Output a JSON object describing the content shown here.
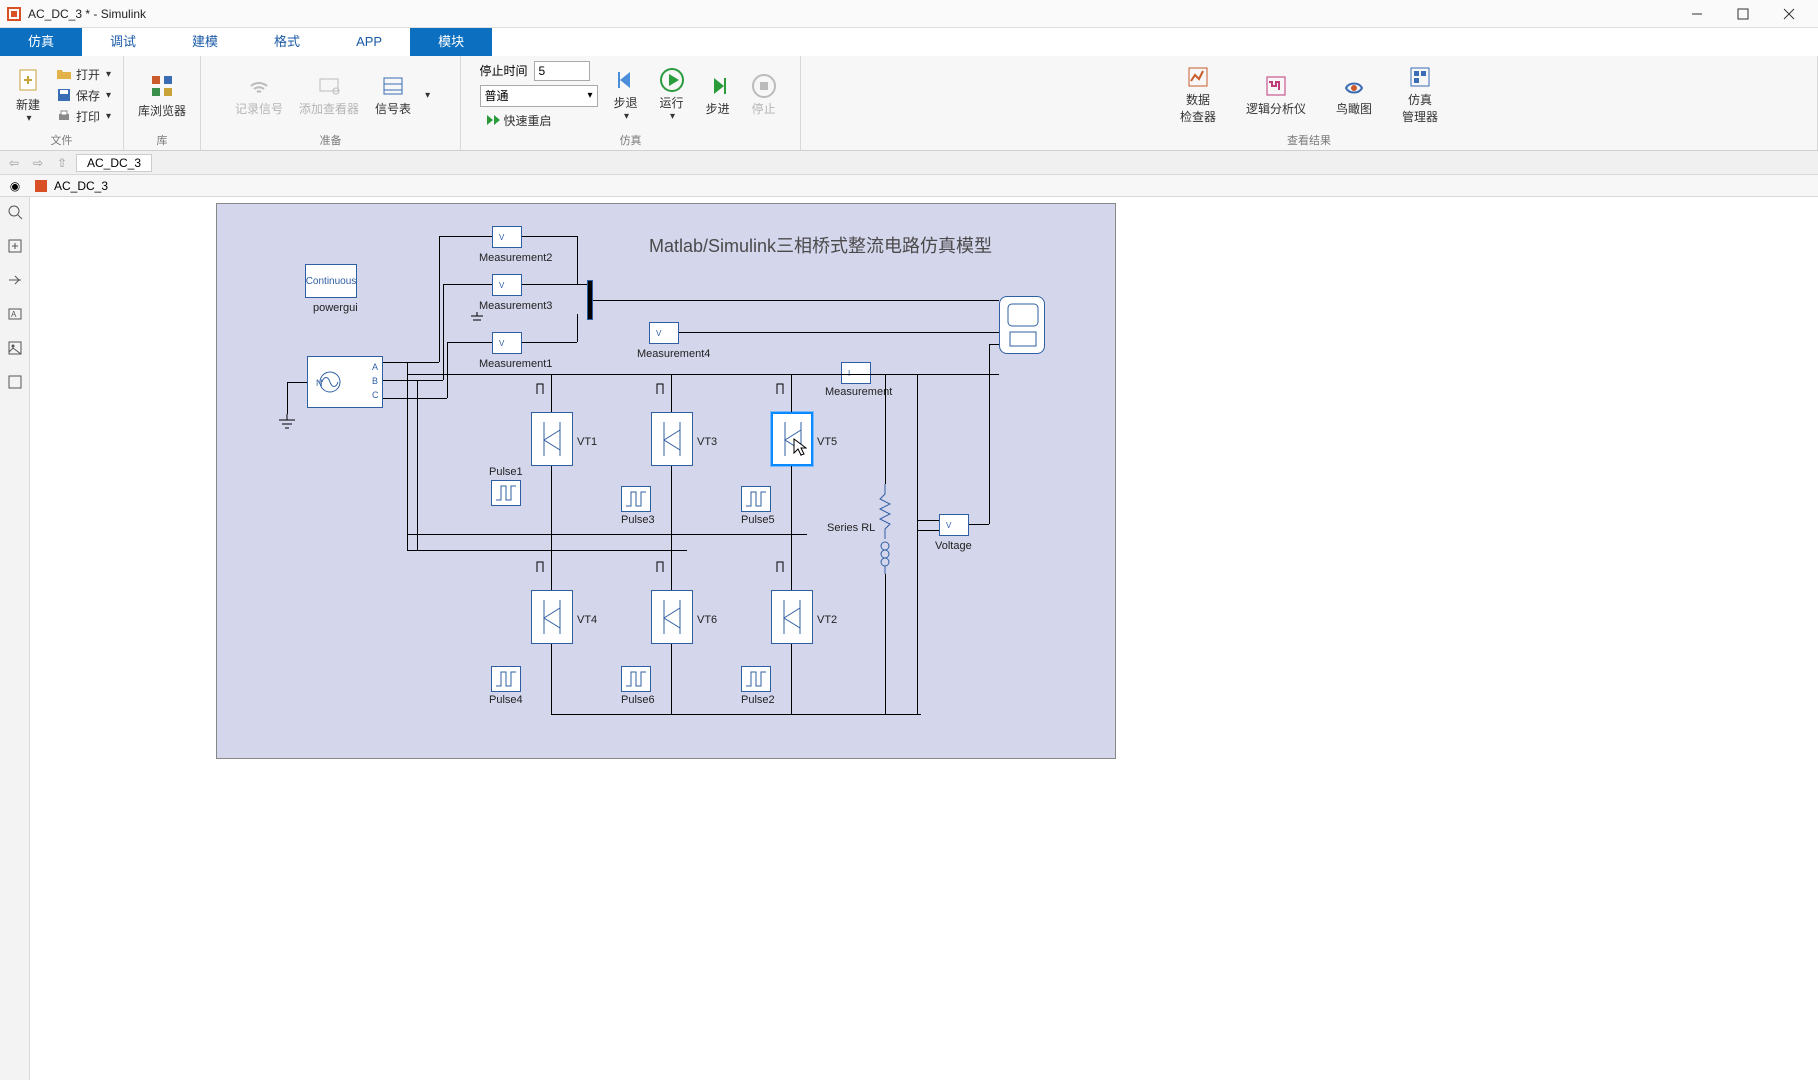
{
  "window": {
    "title": "AC_DC_3 * - Simulink"
  },
  "ribbon_tabs": [
    "仿真",
    "调试",
    "建模",
    "格式",
    "APP",
    "模块"
  ],
  "ribbon_active_index": 0,
  "ribbon_highlight_index": 5,
  "ribbon": {
    "file_group": {
      "new": "新建",
      "open": "打开",
      "save": "保存",
      "print": "打印",
      "label": "文件"
    },
    "library_group": {
      "browser": "库浏览器",
      "label": "库"
    },
    "prep_group": {
      "record_signal": "记录信号",
      "add_viewer": "添加查看器",
      "signal_table": "信号表",
      "label": "准备"
    },
    "sim_group": {
      "stop_time_label": "停止时间",
      "stop_time_value": "5",
      "mode": "普通",
      "fast_restart": "快速重启",
      "step_back": "步退",
      "run": "运行",
      "step_fwd": "步进",
      "stop": "停止",
      "label": "仿真"
    },
    "results_group": {
      "data_inspector": "数据\n检查器",
      "logic_analyzer": "逻辑分析仪",
      "bird": "鸟瞰图",
      "sim_manager": "仿真\n管理器",
      "label": "查看结果"
    }
  },
  "breadcrumb": {
    "tab": "AC_DC_3"
  },
  "explorer": {
    "model_name": "AC_DC_3"
  },
  "diagram": {
    "title": "Matlab/Simulink三相桥式整流电路仿真模型",
    "powergui_text": "Continuous",
    "powergui_label": "powergui",
    "source_ports": [
      "A",
      "B",
      "C"
    ],
    "source_neutral": "N",
    "measurements": [
      "Measurement2",
      "Measurement3",
      "Measurement1",
      "Measurement4",
      "Measurement"
    ],
    "thyristors_top": [
      "VT1",
      "VT3",
      "VT5"
    ],
    "thyristors_bot": [
      "VT4",
      "VT6",
      "VT2"
    ],
    "pulses_top": [
      "Pulse1",
      "Pulse3",
      "Pulse5"
    ],
    "pulses_bot": [
      "Pulse4",
      "Pulse6",
      "Pulse2"
    ],
    "series_rl": "Series RL",
    "voltage": "Voltage"
  }
}
